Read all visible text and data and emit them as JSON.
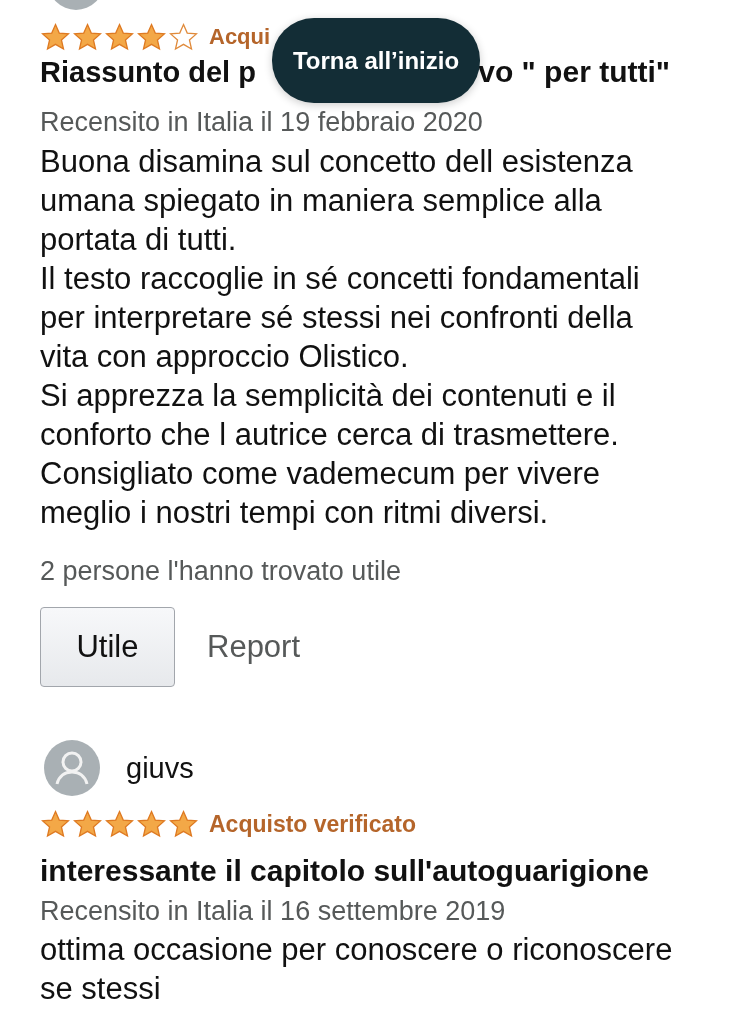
{
  "reviews": [
    {
      "avatar_cut": true,
      "stars": 4,
      "badge": "Acqui",
      "title_parts": [
        "Riassunto del p",
        "vo \" per tutti\""
      ],
      "meta": "Recensito in Italia il 19 febbraio 2020",
      "body": "Buona disamina sul concetto dell esistenza\numana spiegato in maniera semplice alla\nportata di tutti.\nIl testo raccoglie in sé concetti fondamentali\nper interpretare sé stessi nei confronti della\nvita con approccio Olistico.\nSi apprezza la semplicità dei contenuti e il\nconforto che l autrice cerca di trasmettere.\nConsigliato come vademecum per vivere\nmeglio i nostri tempi con ritmi diversi.",
      "helpful": "2 persone l'hanno trovato utile",
      "buttons": {
        "helpful": "Utile",
        "report": "Report"
      }
    },
    {
      "author": "giuvs",
      "stars": 5,
      "badge": "Acquisto verificato",
      "title_parts": [
        "interessante il capitolo sull'autoguarigione"
      ],
      "meta": "Recensito in Italia il 16 settembre 2019",
      "body": "ottima occasione per conoscere o riconoscere\nse stessi"
    }
  ],
  "back_to_top": "Torna all’inizio"
}
